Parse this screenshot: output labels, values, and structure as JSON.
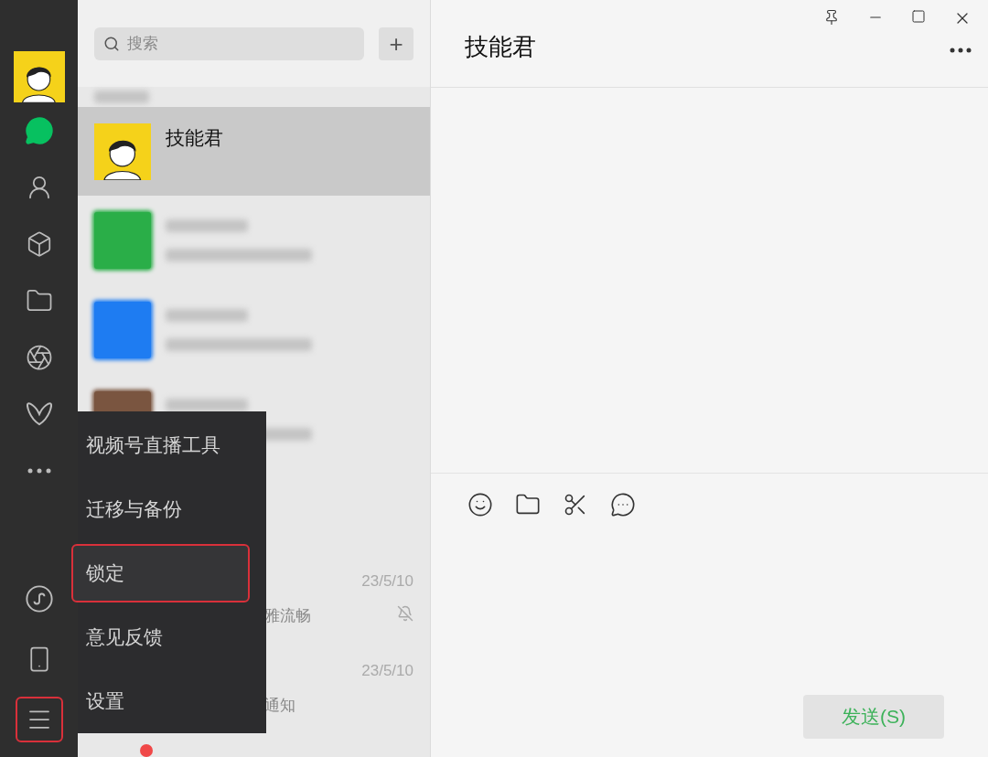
{
  "sidebar": {
    "nav": [
      {
        "kind": "chats",
        "selected": true
      },
      {
        "kind": "contacts",
        "selected": false
      },
      {
        "kind": "cube",
        "selected": false
      },
      {
        "kind": "folder",
        "selected": false
      },
      {
        "kind": "aperture",
        "selected": false
      },
      {
        "kind": "butterfly",
        "selected": false
      },
      {
        "kind": "more",
        "selected": false
      }
    ],
    "bottom": [
      {
        "kind": "miniprogram",
        "highlighted": false
      },
      {
        "kind": "phone",
        "highlighted": false
      },
      {
        "kind": "menu",
        "highlighted": true
      }
    ]
  },
  "search": {
    "placeholder": "搜索",
    "add": "+"
  },
  "chats": [
    {
      "kind": "blurred_top"
    },
    {
      "kind": "contact",
      "name": "技能君",
      "selected": true
    },
    {
      "kind": "blurred",
      "color": "#2aae48"
    },
    {
      "kind": "blurred",
      "color": "#1e7cf2"
    },
    {
      "kind": "blurred",
      "color": "#7a5540"
    },
    {
      "kind": "blank"
    },
    {
      "kind": "partial",
      "time": "23/5/10",
      "preview": "雅流畅",
      "muted": true
    },
    {
      "kind": "partial",
      "time": "23/5/10",
      "preview": "通知"
    },
    {
      "kind": "partial",
      "badge": true
    }
  ],
  "menu": [
    {
      "label": "视频号直播工具",
      "highlighted": false
    },
    {
      "label": "迁移与备份",
      "highlighted": false
    },
    {
      "label": "锁定",
      "highlighted": true
    },
    {
      "label": "意见反馈",
      "highlighted": false
    },
    {
      "label": "设置",
      "highlighted": false
    }
  ],
  "chat": {
    "title": "技能君",
    "send": "发送(S)"
  }
}
